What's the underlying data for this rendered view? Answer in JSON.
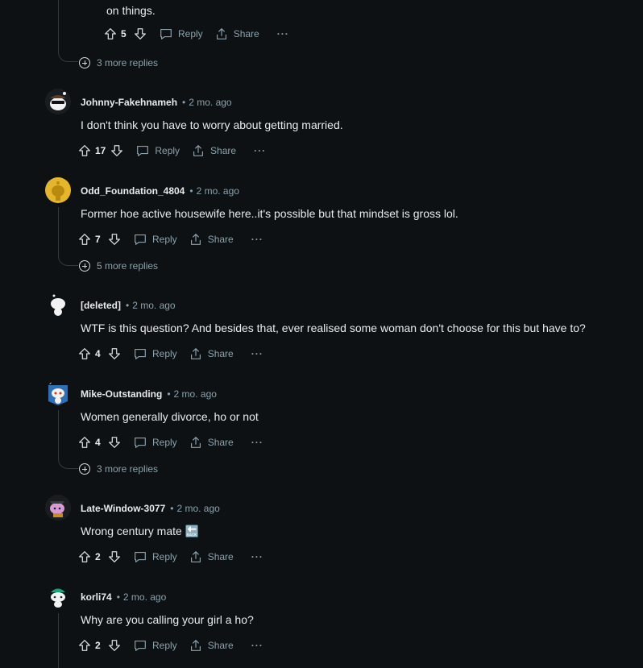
{
  "top_partial": {
    "body_tail": "on things.",
    "score": "5",
    "reply_label": "Reply",
    "share_label": "Share",
    "more_label": "···",
    "more_replies": "3 more replies"
  },
  "comments": [
    {
      "author": "Johnny-Fakehnameh",
      "time": "2 mo. ago",
      "body": "I don't think you have to worry about getting married.",
      "score": "17",
      "reply_label": "Reply",
      "share_label": "Share",
      "more_label": "···",
      "avatar": "snoo-sunglasses-avatar"
    },
    {
      "author": "Odd_Foundation_4804",
      "time": "2 mo. ago",
      "body": "Former hoe active housewife here..it's possible but that mindset is gross lol.",
      "score": "7",
      "reply_label": "Reply",
      "share_label": "Share",
      "more_label": "···",
      "more_replies": "5 more replies",
      "avatar": "yellow-snoo-avatar"
    },
    {
      "author": "[deleted]",
      "time": "2 mo. ago",
      "body": "WTF is this question? And besides that, ever realised some woman don't choose for this but have to?",
      "score": "4",
      "reply_label": "Reply",
      "share_label": "Share",
      "more_label": "···",
      "avatar": "deleted-snoo-avatar"
    },
    {
      "author": "Mike-Outstanding",
      "time": "2 mo. ago",
      "body": "Women generally divorce, ho or not",
      "score": "4",
      "reply_label": "Reply",
      "share_label": "Share",
      "more_label": "···",
      "more_replies": "3 more replies",
      "avatar": "snoo-blue-avatar"
    },
    {
      "author": "Late-Window-3077",
      "time": "2 mo. ago",
      "body": "Wrong century mate 🔙",
      "score": "2",
      "reply_label": "Reply",
      "share_label": "Share",
      "more_label": "···",
      "avatar": "pink-snoo-avatar"
    },
    {
      "author": "korli74",
      "time": "2 mo. ago",
      "body": "Why are you calling your girl a ho?",
      "score": "2",
      "reply_label": "Reply",
      "share_label": "Share",
      "more_label": "···",
      "avatar": "green-hat-snoo-avatar"
    }
  ],
  "colors": {
    "background": "#0e1113",
    "text": "#d7dadc",
    "muted": "#8ba2ad",
    "thread_line": "#33393d"
  }
}
